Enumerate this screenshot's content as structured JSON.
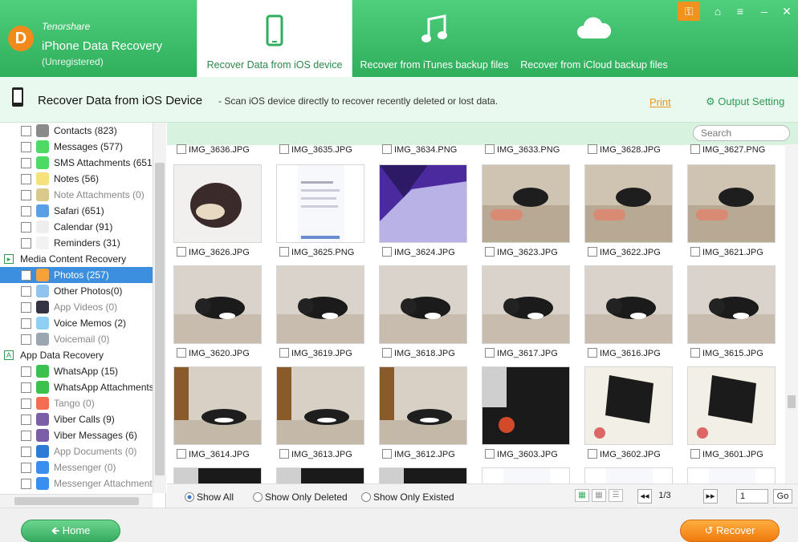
{
  "app": {
    "vendor": "Tenorshare",
    "name": "iPhone Data Recovery",
    "status": "(Unregistered)",
    "logo_letter": "D",
    "accent": "#37b462",
    "orange": "#f0921e"
  },
  "tabs": [
    {
      "label": "Recover Data from iOS device",
      "icon": "phone-icon"
    },
    {
      "label": "Recover from iTunes backup files",
      "icon": "music-note-icon"
    },
    {
      "label": "Recover from iCloud backup files",
      "icon": "cloud-icon"
    }
  ],
  "subheader": {
    "title": "Recover Data from iOS Device",
    "description": "- Scan iOS device directly to recover recently deleted or lost data.",
    "print": "Print",
    "output_setting": "Output Setting"
  },
  "sidebar": {
    "items": [
      {
        "label": "Contacts (823)",
        "icon": "contacts-icon",
        "color": "#8a8a8a"
      },
      {
        "label": "Messages (577)",
        "icon": "messages-icon",
        "color": "#4cd964"
      },
      {
        "label": "SMS Attachments (651)",
        "icon": "paperclip-icon",
        "color": "#4cd964"
      },
      {
        "label": "Notes (56)",
        "icon": "notes-icon",
        "color": "#f5e27a"
      },
      {
        "label": "Note Attachments (0)",
        "icon": "note-attachment-icon",
        "color": "#d9c98a",
        "disabled": true
      },
      {
        "label": "Safari (651)",
        "icon": "safari-icon",
        "color": "#5aa0e6"
      },
      {
        "label": "Calendar (91)",
        "icon": "calendar-icon",
        "color": "#eeeeee"
      },
      {
        "label": "Reminders (31)",
        "icon": "reminders-icon",
        "color": "#f2f2f2"
      },
      {
        "label": "Media Content Recovery",
        "group": true
      },
      {
        "label": "Photos (257)",
        "icon": "photos-icon",
        "color": "#f7a13a",
        "selected": true
      },
      {
        "label": "Other Photos(0)",
        "icon": "other-photos-icon",
        "color": "#8fc3f0"
      },
      {
        "label": "App Videos (0)",
        "icon": "app-videos-icon",
        "color": "#334",
        "disabled": true
      },
      {
        "label": "Voice Memos (2)",
        "icon": "microphone-icon",
        "color": "#8ed0f5"
      },
      {
        "label": "Voicemail (0)",
        "icon": "voicemail-icon",
        "color": "#9ba7b0",
        "disabled": true
      },
      {
        "label": "App Data Recovery",
        "group": true
      },
      {
        "label": "WhatsApp (15)",
        "icon": "whatsapp-icon",
        "color": "#3cc14f"
      },
      {
        "label": "WhatsApp Attachments (",
        "icon": "whatsapp-attachments-icon",
        "color": "#3cc14f"
      },
      {
        "label": "Tango (0)",
        "icon": "tango-icon",
        "color": "#f26e4e",
        "disabled": true
      },
      {
        "label": "Viber Calls (9)",
        "icon": "viber-icon",
        "color": "#7b5ea8"
      },
      {
        "label": "Viber Messages (6)",
        "icon": "viber-messages-icon",
        "color": "#7b5ea8"
      },
      {
        "label": "App Documents (0)",
        "icon": "app-documents-icon",
        "color": "#2e7bd6",
        "disabled": true
      },
      {
        "label": "Messenger (0)",
        "icon": "messenger-icon",
        "color": "#3a8ef0",
        "disabled": true
      },
      {
        "label": "Messenger Attachments (",
        "icon": "messenger-attachments-icon",
        "color": "#3a8ef0",
        "disabled": true
      }
    ]
  },
  "search": {
    "placeholder": "Search"
  },
  "grid": {
    "top_row": [
      "IMG_3636.JPG",
      "IMG_3635.JPG",
      "IMG_3634.PNG",
      "IMG_3633.PNG",
      "IMG_3628.JPG",
      "IMG_3627.PNG"
    ],
    "rows": [
      [
        {
          "name": "IMG_3626.JPG",
          "scene": "food"
        },
        {
          "name": "IMG_3625.PNG",
          "scene": "screenshot"
        },
        {
          "name": "IMG_3624.JPG",
          "scene": "purple"
        },
        {
          "name": "IMG_3623.JPG",
          "scene": "cat-play"
        },
        {
          "name": "IMG_3622.JPG",
          "scene": "cat-play"
        },
        {
          "name": "IMG_3621.JPG",
          "scene": "cat-play"
        }
      ],
      [
        {
          "name": "IMG_3620.JPG",
          "scene": "cat-sleep"
        },
        {
          "name": "IMG_3619.JPG",
          "scene": "cat-sleep"
        },
        {
          "name": "IMG_3618.JPG",
          "scene": "cat-sleep"
        },
        {
          "name": "IMG_3617.JPG",
          "scene": "cat-sleep"
        },
        {
          "name": "IMG_3616.JPG",
          "scene": "cat-sleep"
        },
        {
          "name": "IMG_3615.JPG",
          "scene": "cat-sleep"
        }
      ],
      [
        {
          "name": "IMG_3614.JPG",
          "scene": "cat-room"
        },
        {
          "name": "IMG_3613.JPG",
          "scene": "cat-room"
        },
        {
          "name": "IMG_3612.JPG",
          "scene": "cat-room"
        },
        {
          "name": "IMG_3603.JPG",
          "scene": "dark"
        },
        {
          "name": "IMG_3602.JPG",
          "scene": "cat-window"
        },
        {
          "name": "IMG_3601.JPG",
          "scene": "cat-window"
        }
      ]
    ],
    "bottom_row": [
      "dark",
      "dark",
      "dark",
      "screenshot",
      "screenshot",
      "screenshot"
    ]
  },
  "filters": {
    "show_all": "Show All",
    "only_deleted": "Show Only Deleted",
    "only_existed": "Show Only Existed"
  },
  "pagination": {
    "page_label": "1/3",
    "page_input": "1",
    "go": "Go"
  },
  "footer": {
    "home": "Home",
    "recover": "Recover"
  }
}
